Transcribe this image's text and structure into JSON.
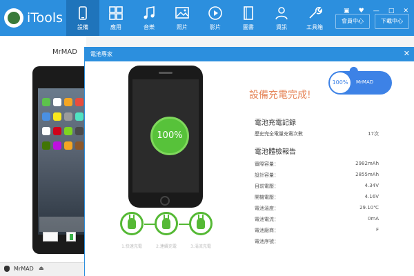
{
  "app": {
    "name": "iTools"
  },
  "nav": [
    {
      "label": "設備",
      "icon": "device-icon",
      "active": true
    },
    {
      "label": "應用",
      "icon": "apps-icon",
      "active": false
    },
    {
      "label": "音樂",
      "icon": "music-icon",
      "active": false
    },
    {
      "label": "照片",
      "icon": "photo-icon",
      "active": false
    },
    {
      "label": "影片",
      "icon": "video-icon",
      "active": false
    },
    {
      "label": "圖書",
      "icon": "book-icon",
      "active": false
    },
    {
      "label": "資訊",
      "icon": "contacts-icon",
      "active": false
    },
    {
      "label": "工具箱",
      "icon": "toolbox-icon",
      "active": false
    }
  ],
  "toolbar": {
    "member_label": "會員中心",
    "download_label": "下載中心"
  },
  "window_controls": [
    "▣",
    "♥",
    "—",
    "□",
    "✕"
  ],
  "device": {
    "name": "MrMAD"
  },
  "statusbar": {
    "device_name": "MrMAD",
    "eject": "⏏"
  },
  "dialog": {
    "title": "電池專家",
    "close": "✕",
    "battery_percent": "100%",
    "badge_percent": "100%",
    "badge_name": "MrMAD",
    "headline": "設備充電完成!",
    "charge_record_title": "電池充電記錄",
    "charge_record": [
      {
        "key": "歷史完全電量充電次數",
        "value": "17次"
      }
    ],
    "health_title": "電池體檢報告",
    "health": [
      {
        "key": "實際容量：",
        "value": "2982mAh"
      },
      {
        "key": "設計容量：",
        "value": "2855mAh"
      },
      {
        "key": "目前電壓：",
        "value": "4.34V"
      },
      {
        "key": "開機電壓：",
        "value": "4.16V"
      },
      {
        "key": "電池溫度：",
        "value": "29.10℃"
      },
      {
        "key": "電池電流：",
        "value": "0mA"
      },
      {
        "key": "電池廠商：",
        "value": "F"
      },
      {
        "key": "電池序號：",
        "value": ""
      }
    ],
    "stages": [
      "1.快速充電",
      "2.連續充電",
      "3.涓流充電"
    ]
  },
  "colors": {
    "accent": "#2c8fde",
    "green": "#55b935",
    "headline": "#e6865a"
  }
}
